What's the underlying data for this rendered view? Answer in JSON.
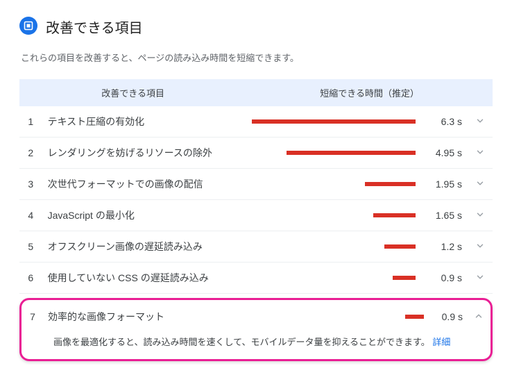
{
  "header": {
    "title": "改善できる項目",
    "description": "これらの項目を改善すると、ページの読み込み時間を短縮できます。"
  },
  "columns": {
    "opportunity": "改善できる項目",
    "estimated": "短縮できる時間（推定）"
  },
  "items": [
    {
      "n": "1",
      "title": "テキスト圧縮の有効化",
      "seconds": "6.3 s",
      "barpct": 100,
      "expanded": false
    },
    {
      "n": "2",
      "title": "レンダリングを妨げるリソースの除外",
      "seconds": "4.95 s",
      "barpct": 79,
      "expanded": false
    },
    {
      "n": "3",
      "title": "次世代フォーマットでの画像の配信",
      "seconds": "1.95 s",
      "barpct": 31,
      "expanded": false
    },
    {
      "n": "4",
      "title": "JavaScript の最小化",
      "seconds": "1.65 s",
      "barpct": 26,
      "expanded": false
    },
    {
      "n": "5",
      "title": "オフスクリーン画像の遅延読み込み",
      "seconds": "1.2 s",
      "barpct": 19,
      "expanded": false
    },
    {
      "n": "6",
      "title": "使用していない CSS の遅延読み込み",
      "seconds": "0.9 s",
      "barpct": 14,
      "expanded": false
    }
  ],
  "highlighted": {
    "n": "7",
    "title": "効率的な画像フォーマット",
    "seconds": "0.9 s",
    "barpct": 14,
    "expanded": true,
    "detail_text": "画像を最適化すると、読み込み時間を速くして、モバイルデータ量を抑えることができます。",
    "detail_link": "詳細"
  },
  "chart_data": {
    "type": "bar",
    "title": "改善できる項目",
    "xlabel": "短縮できる時間（推定）",
    "ylabel": "改善できる項目",
    "categories": [
      "テキスト圧縮の有効化",
      "レンダリングを妨げるリソースの除外",
      "次世代フォーマットでの画像の配信",
      "JavaScript の最小化",
      "オフスクリーン画像の遅延読み込み",
      "使用していない CSS の遅延読み込み",
      "効率的な画像フォーマット"
    ],
    "values": [
      6.3,
      4.95,
      1.95,
      1.65,
      1.2,
      0.9,
      0.9
    ],
    "unit": "s",
    "xlim": [
      0,
      6.3
    ]
  }
}
